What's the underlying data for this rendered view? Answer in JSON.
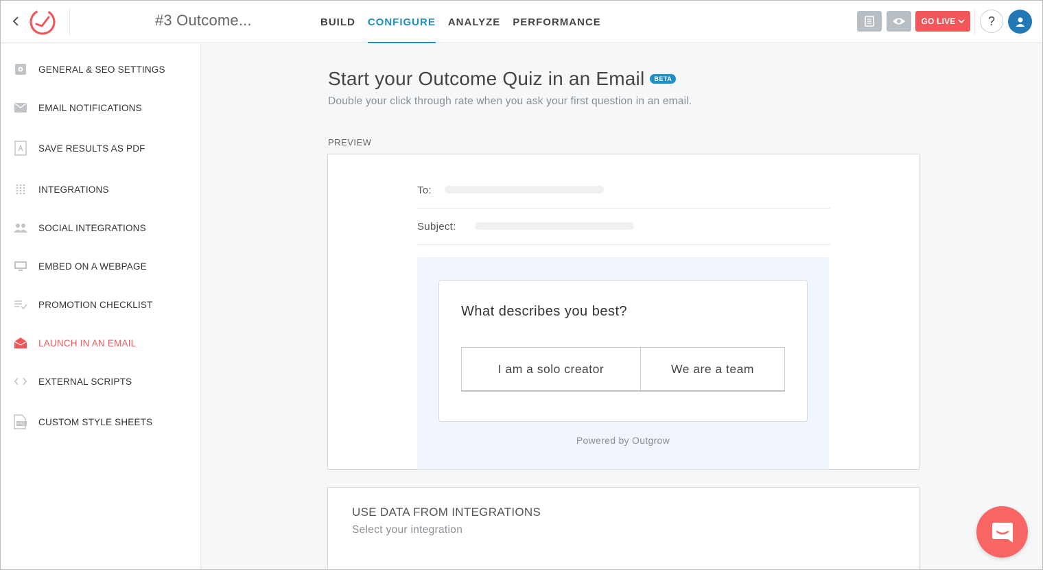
{
  "header": {
    "quiz_title": "#3 Outcome...",
    "tabs": [
      {
        "label": "BUILD",
        "active": false
      },
      {
        "label": "CONFIGURE",
        "active": true
      },
      {
        "label": "ANALYZE",
        "active": false
      },
      {
        "label": "PERFORMANCE",
        "active": false
      }
    ],
    "go_live_label": "GO LIVE",
    "help_label": "?"
  },
  "sidebar": {
    "items": [
      {
        "label": "GENERAL & SEO SETTINGS",
        "icon": "gear-icon",
        "active": false
      },
      {
        "label": "EMAIL NOTIFICATIONS",
        "icon": "envelope-icon",
        "active": false
      },
      {
        "label": "SAVE RESULTS AS PDF",
        "icon": "pdf-icon",
        "active": false
      },
      {
        "label": "INTEGRATIONS",
        "icon": "grid-dots-icon",
        "active": false
      },
      {
        "label": "SOCIAL INTEGRATIONS",
        "icon": "people-icon",
        "active": false
      },
      {
        "label": "EMBED ON A WEBPAGE",
        "icon": "monitor-icon",
        "active": false
      },
      {
        "label": "PROMOTION CHECKLIST",
        "icon": "checklist-icon",
        "active": false
      },
      {
        "label": "LAUNCH IN AN EMAIL",
        "icon": "open-envelope-icon",
        "active": true
      },
      {
        "label": "EXTERNAL SCRIPTS",
        "icon": "code-brackets-icon",
        "active": false
      },
      {
        "label": "CUSTOM STYLE SHEETS",
        "icon": "css-file-icon",
        "active": false
      }
    ]
  },
  "main": {
    "title": "Start your Outcome Quiz in an Email",
    "badge": "BETA",
    "subtitle": "Double your click through rate when you ask your first question in an email.",
    "preview_label": "PREVIEW",
    "email": {
      "to_label": "To:",
      "subject_label": "Subject:",
      "question": "What describes you best?",
      "answers": [
        "I am a solo creator",
        "We are a team"
      ],
      "powered_by": "Powered by Outgrow"
    },
    "integrations": {
      "title": "USE DATA FROM INTEGRATIONS",
      "subtitle": "Select your integration"
    }
  },
  "colors": {
    "accent_blue": "#1e8fc6",
    "accent_red": "#f0575a",
    "chat_red": "#f76664",
    "avatar_blue": "#2379b5"
  }
}
